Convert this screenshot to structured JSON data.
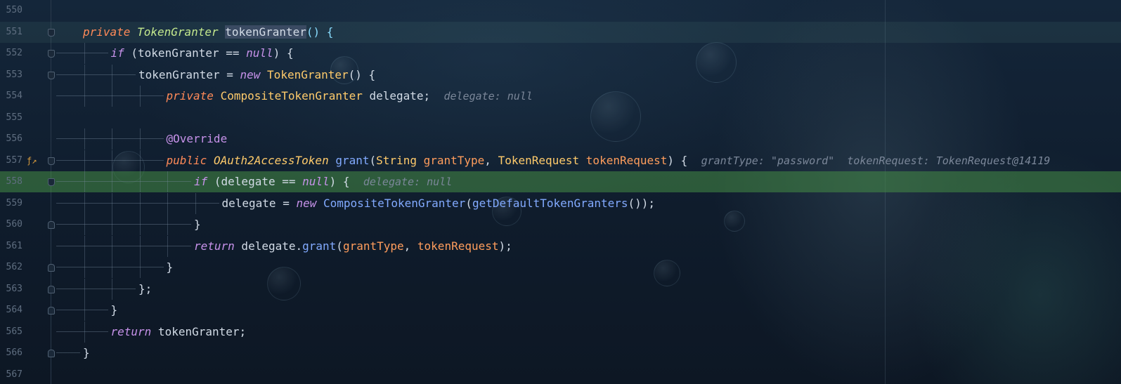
{
  "editor": {
    "lines": [
      {
        "num": "550",
        "indent": 0,
        "parts": []
      },
      {
        "num": "551",
        "indent": 1,
        "current": true,
        "parts": [
          {
            "t": "private ",
            "c": "mod"
          },
          {
            "t": "TokenGranter",
            "c": "itype"
          },
          {
            "t": " "
          },
          {
            "t": "tokenGranter",
            "c": "sel"
          },
          {
            "t": "() ",
            "c": "punc"
          },
          {
            "t": "{",
            "c": "punc"
          }
        ]
      },
      {
        "num": "552",
        "indent": 2,
        "parts": [
          {
            "t": "if",
            "c": "kw"
          },
          {
            "t": " ("
          },
          {
            "t": "tokenGranter"
          },
          {
            "t": " == "
          },
          {
            "t": "null",
            "c": "kw"
          },
          {
            "t": ") {"
          }
        ]
      },
      {
        "num": "553",
        "indent": 3,
        "parts": [
          {
            "t": "tokenGranter = "
          },
          {
            "t": "new",
            "c": "kw"
          },
          {
            "t": " "
          },
          {
            "t": "TokenGranter",
            "c": "type"
          },
          {
            "t": "() {"
          }
        ]
      },
      {
        "num": "554",
        "indent": 4,
        "parts": [
          {
            "t": "private ",
            "c": "mod"
          },
          {
            "t": "CompositeTokenGranter",
            "c": "type"
          },
          {
            "t": " delegate;  "
          },
          {
            "t": "delegate: null",
            "c": "hint"
          }
        ]
      },
      {
        "num": "555",
        "indent": 0,
        "parts": []
      },
      {
        "num": "556",
        "indent": 4,
        "parts": [
          {
            "t": "@Override",
            "c": "anno"
          }
        ]
      },
      {
        "num": "557",
        "indent": 4,
        "icon": "fx",
        "parts": [
          {
            "t": "public ",
            "c": "mod"
          },
          {
            "t": "OAuth2AccessToken",
            "c": "itype2"
          },
          {
            "t": " "
          },
          {
            "t": "grant",
            "c": "fn"
          },
          {
            "t": "("
          },
          {
            "t": "String",
            "c": "type"
          },
          {
            "t": " "
          },
          {
            "t": "grantType",
            "c": "param"
          },
          {
            "t": ", "
          },
          {
            "t": "TokenRequest",
            "c": "type"
          },
          {
            "t": " "
          },
          {
            "t": "tokenRequest",
            "c": "param"
          },
          {
            "t": ") {  "
          },
          {
            "t": "grantType: \"password\"  tokenRequest: TokenRequest@14119",
            "c": "hint"
          }
        ]
      },
      {
        "num": "558",
        "indent": 5,
        "exec": true,
        "parts": [
          {
            "t": "if",
            "c": "kw"
          },
          {
            "t": " (delegate == "
          },
          {
            "t": "null",
            "c": "kw"
          },
          {
            "t": ") {  "
          },
          {
            "t": "delegate: null",
            "c": "hint"
          }
        ]
      },
      {
        "num": "559",
        "indent": 6,
        "parts": [
          {
            "t": "delegate = "
          },
          {
            "t": "new",
            "c": "kw"
          },
          {
            "t": " "
          },
          {
            "t": "CompositeTokenGranter",
            "c": "fn"
          },
          {
            "t": "("
          },
          {
            "t": "getDefaultTokenGranters",
            "c": "fn"
          },
          {
            "t": "());"
          }
        ]
      },
      {
        "num": "560",
        "indent": 5,
        "parts": [
          {
            "t": "}"
          }
        ]
      },
      {
        "num": "561",
        "indent": 5,
        "parts": [
          {
            "t": "return",
            "c": "kw"
          },
          {
            "t": " delegate."
          },
          {
            "t": "grant",
            "c": "fn"
          },
          {
            "t": "("
          },
          {
            "t": "grantType",
            "c": "param"
          },
          {
            "t": ", "
          },
          {
            "t": "tokenRequest",
            "c": "param"
          },
          {
            "t": ");"
          }
        ]
      },
      {
        "num": "562",
        "indent": 4,
        "parts": [
          {
            "t": "}"
          }
        ]
      },
      {
        "num": "563",
        "indent": 3,
        "parts": [
          {
            "t": "};"
          }
        ]
      },
      {
        "num": "564",
        "indent": 2,
        "parts": [
          {
            "t": "}"
          }
        ]
      },
      {
        "num": "565",
        "indent": 2,
        "parts": [
          {
            "t": "return",
            "c": "kw"
          },
          {
            "t": " tokenGranter;"
          }
        ]
      },
      {
        "num": "566",
        "indent": 1,
        "parts": [
          {
            "t": "}"
          }
        ]
      },
      {
        "num": "567",
        "indent": 0,
        "parts": []
      }
    ]
  }
}
